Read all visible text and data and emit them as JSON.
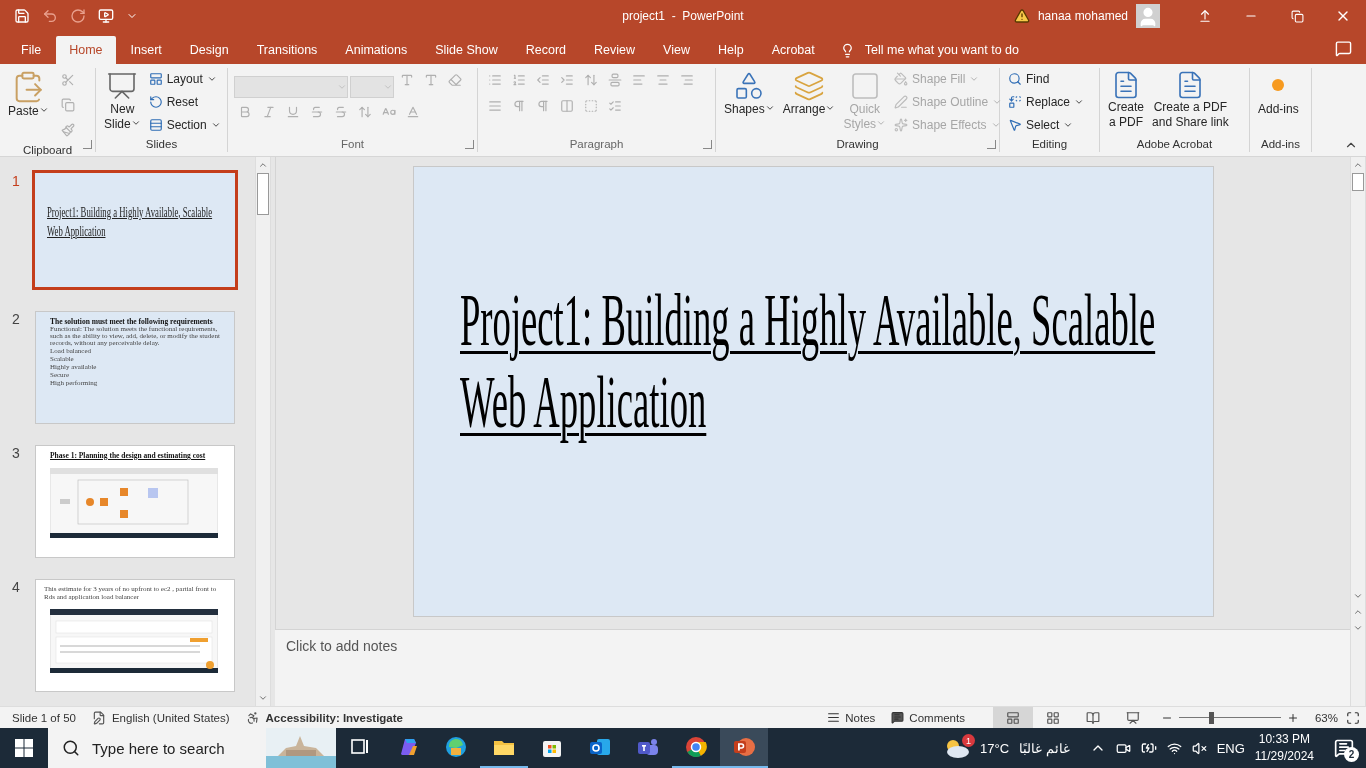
{
  "title_bar": {
    "title": "project1  -  PowerPoint",
    "user": "hanaa mohamed"
  },
  "tabs": [
    {
      "label": "File",
      "selected": false
    },
    {
      "label": "Home",
      "selected": true
    },
    {
      "label": "Insert",
      "selected": false
    },
    {
      "label": "Design",
      "selected": false
    },
    {
      "label": "Transitions",
      "selected": false
    },
    {
      "label": "Animations",
      "selected": false
    },
    {
      "label": "Slide Show",
      "selected": false
    },
    {
      "label": "Record",
      "selected": false
    },
    {
      "label": "Review",
      "selected": false
    },
    {
      "label": "View",
      "selected": false
    },
    {
      "label": "Help",
      "selected": false
    },
    {
      "label": "Acrobat",
      "selected": false
    }
  ],
  "tell_me": {
    "placeholder": "Tell me what you want to do"
  },
  "ribbon": [
    {
      "name": "Clipboard",
      "disabled": false,
      "launcher": true,
      "items": [
        {
          "kind": "large",
          "label": "Paste",
          "disabled": false,
          "dropdown": true
        },
        {
          "kind": "icon",
          "disabled": true
        },
        {
          "kind": "icon",
          "disabled": true
        },
        {
          "kind": "icon",
          "disabled": true
        }
      ]
    },
    {
      "name": "Slides",
      "disabled": false,
      "items": [
        {
          "kind": "large",
          "label": "New\nSlide",
          "disabled": false,
          "dropdown": true
        },
        {
          "kind": "small",
          "label": "Layout",
          "disabled": false,
          "dropdown": true
        },
        {
          "kind": "small",
          "label": "Reset",
          "disabled": false,
          "dropdown": false
        },
        {
          "kind": "small",
          "label": "Section",
          "disabled": false,
          "dropdown": true
        }
      ]
    },
    {
      "name": "Font",
      "disabled": true,
      "launcher": true,
      "items": [
        {
          "kind": "combo",
          "disabled": true
        },
        {
          "kind": "combo",
          "disabled": true
        },
        {
          "kind": "icon",
          "disabled": true
        },
        {
          "kind": "icon",
          "disabled": true
        },
        {
          "kind": "icon",
          "disabled": true
        },
        {
          "kind": "icon",
          "disabled": true
        },
        {
          "kind": "icon",
          "disabled": true
        },
        {
          "kind": "icon",
          "disabled": true
        },
        {
          "kind": "icon",
          "disabled": true
        },
        {
          "kind": "icon",
          "disabled": true
        },
        {
          "kind": "icon",
          "disabled": true
        },
        {
          "kind": "icon",
          "disabled": true
        },
        {
          "kind": "icon",
          "disabled": true
        }
      ]
    },
    {
      "name": "Paragraph",
      "disabled": true,
      "launcher": true,
      "items": [
        {
          "kind": "icon",
          "disabled": true
        },
        {
          "kind": "icon",
          "disabled": true
        },
        {
          "kind": "icon",
          "disabled": true
        },
        {
          "kind": "icon",
          "disabled": true
        },
        {
          "kind": "icon",
          "disabled": true
        },
        {
          "kind": "icon",
          "disabled": true
        },
        {
          "kind": "icon",
          "disabled": true
        },
        {
          "kind": "icon",
          "disabled": true
        },
        {
          "kind": "icon",
          "disabled": true
        },
        {
          "kind": "icon",
          "disabled": true
        },
        {
          "kind": "icon",
          "disabled": true
        },
        {
          "kind": "icon",
          "disabled": true
        },
        {
          "kind": "icon",
          "disabled": true
        },
        {
          "kind": "icon",
          "disabled": true
        },
        {
          "kind": "icon",
          "disabled": true
        }
      ]
    },
    {
      "name": "Drawing",
      "disabled": false,
      "launcher": true,
      "items": [
        {
          "kind": "large",
          "label": "Shapes",
          "disabled": false,
          "dropdown": true
        },
        {
          "kind": "large",
          "label": "Arrange",
          "disabled": false,
          "dropdown": true
        },
        {
          "kind": "large",
          "label": "Quick\nStyles",
          "disabled": true,
          "dropdown": true
        },
        {
          "kind": "small",
          "label": "Shape Fill",
          "disabled": true,
          "dropdown": true
        },
        {
          "kind": "small",
          "label": "Shape Outline",
          "disabled": true,
          "dropdown": true
        },
        {
          "kind": "small",
          "label": "Shape Effects",
          "disabled": true,
          "dropdown": true
        }
      ]
    },
    {
      "name": "Editing",
      "disabled": false,
      "items": [
        {
          "kind": "small",
          "label": "Find",
          "disabled": false,
          "dropdown": false
        },
        {
          "kind": "small",
          "label": "Replace",
          "disabled": false,
          "dropdown": true
        },
        {
          "kind": "small",
          "label": "Select",
          "disabled": false,
          "dropdown": true
        }
      ]
    },
    {
      "name": "Adobe Acrobat",
      "disabled": false,
      "items": [
        {
          "kind": "large",
          "label": "Create\na PDF",
          "disabled": false,
          "dropdown": false
        },
        {
          "kind": "large",
          "label": "Create a PDF\nand Share link",
          "disabled": false,
          "dropdown": false
        }
      ]
    },
    {
      "name": "Add-ins",
      "disabled": false,
      "items": [
        {
          "kind": "large",
          "label": "Add-ins",
          "disabled": false,
          "dropdown": false
        }
      ]
    }
  ],
  "slides": [
    {
      "number": "1",
      "selected": true,
      "kind": "title",
      "color": "#dde8f4",
      "title": "Project1: Building a Highly Available, Scalable Web Application"
    },
    {
      "number": "2",
      "selected": false,
      "kind": "bullets",
      "color": "#dde8f4",
      "heading": "The solution must meet the following requirements",
      "lines": [
        "Functional: The solution meets the functional requirements, such as the ability to view, add, delete, or modify the student records, without any perceivable delay.",
        "Load balanced",
        "Scalable",
        "Highly available",
        "Secure",
        "High performing"
      ]
    },
    {
      "number": "3",
      "selected": false,
      "kind": "heading_picture",
      "color": "#ffffff",
      "heading": "Phase 1: Planning the design and estimating cost"
    },
    {
      "number": "4",
      "selected": false,
      "kind": "text_picture",
      "color": "#ffffff",
      "text": "This estimate for 3 years  of no upfront to ec2 , partial front to Rds and application load balancer"
    }
  ],
  "current_slide": {
    "title": "Project1: Building a Highly Available, Scalable Web Application"
  },
  "notes": {
    "placeholder": "Click to add notes"
  },
  "status_bar": {
    "slide_info": "Slide 1 of 50",
    "language": "English (United States)",
    "accessibility": "Accessibility: Investigate",
    "notes": "Notes",
    "comments": "Comments",
    "views": [
      {
        "selected": true
      },
      {
        "selected": false
      },
      {
        "selected": false
      },
      {
        "selected": false
      }
    ],
    "zoom": {
      "level": 0.31,
      "reading": "63%"
    }
  },
  "taskbar": {
    "search": {
      "placeholder": "Type here to search"
    },
    "apps": [
      {
        "running": false,
        "active": false
      },
      {
        "running": false,
        "active": false
      },
      {
        "running": false,
        "active": false
      },
      {
        "running": true,
        "active": false
      },
      {
        "running": false,
        "active": false
      },
      {
        "running": false,
        "active": false
      },
      {
        "running": false,
        "active": false
      },
      {
        "running": true,
        "active": false
      },
      {
        "running": true,
        "active": true
      }
    ],
    "weather": {
      "badge": "1",
      "temperature": "17°C",
      "condition": "غائم غالبًا"
    },
    "language": "ENG",
    "time": "10:33 PM",
    "date": "11/29/2024",
    "notifications": "2"
  }
}
